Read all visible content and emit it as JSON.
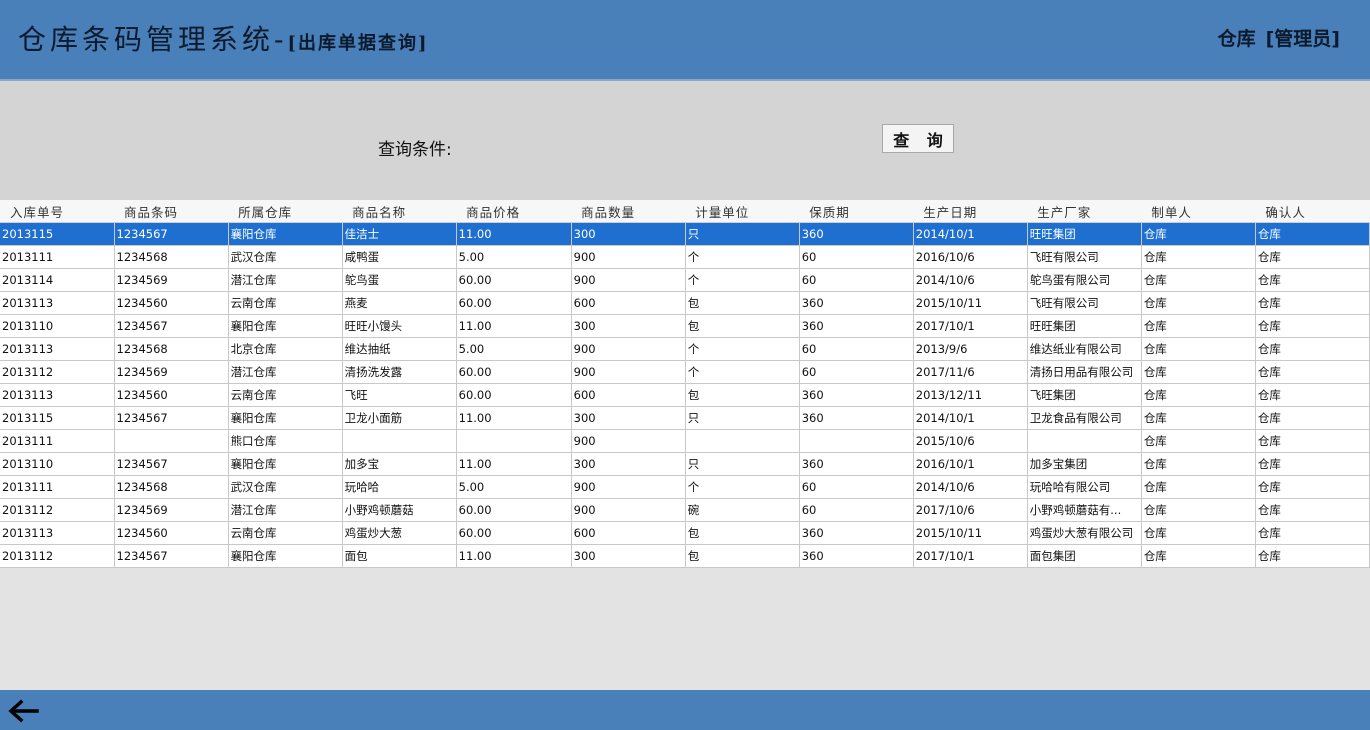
{
  "header": {
    "title": "仓库条码管理系统-",
    "subtitle": "[出库单据查询]",
    "user_name": "仓库",
    "user_role": "[管理员]"
  },
  "query": {
    "label": "查询条件:",
    "button_label": "查 询"
  },
  "table": {
    "columns": [
      "入库单号",
      "商品条码",
      "所属仓库",
      "商品名称",
      "商品价格",
      "商品数量",
      "计量单位",
      "保质期",
      "生产日期",
      "生产厂家",
      "制单人",
      "确认人"
    ],
    "selected_row": 0,
    "rows": [
      [
        "2013115",
        "1234567",
        "襄阳仓库",
        "佳洁士",
        "11.00",
        "300",
        "只",
        "360",
        "2014/10/1",
        "旺旺集团",
        "仓库",
        "仓库"
      ],
      [
        "2013111",
        "1234568",
        "武汉仓库",
        "咸鸭蛋",
        "5.00",
        "900",
        "个",
        "60",
        "2016/10/6",
        "飞旺有限公司",
        "仓库",
        "仓库"
      ],
      [
        "2013114",
        "1234569",
        "潜江仓库",
        "鸵鸟蛋",
        "60.00",
        "900",
        "个",
        "60",
        "2014/10/6",
        "鸵鸟蛋有限公司",
        "仓库",
        "仓库"
      ],
      [
        "2013113",
        "1234560",
        "云南仓库",
        "燕麦",
        "60.00",
        "600",
        "包",
        "360",
        "2015/10/11",
        "飞旺有限公司",
        "仓库",
        "仓库"
      ],
      [
        "2013110",
        "1234567",
        "襄阳仓库",
        "旺旺小馒头",
        "11.00",
        "300",
        "包",
        "360",
        "2017/10/1",
        "旺旺集团",
        "仓库",
        "仓库"
      ],
      [
        "2013113",
        "1234568",
        "北京仓库",
        "维达抽纸",
        "5.00",
        "900",
        "个",
        "60",
        "2013/9/6",
        "维达纸业有限公司",
        "仓库",
        "仓库"
      ],
      [
        "2013112",
        "1234569",
        "潜江仓库",
        "清扬洗发露",
        "60.00",
        "900",
        "个",
        "60",
        "2017/11/6",
        "清扬日用品有限公司",
        "仓库",
        "仓库"
      ],
      [
        "2013113",
        "1234560",
        "云南仓库",
        "飞旺",
        "60.00",
        "600",
        "包",
        "360",
        "2013/12/11",
        "飞旺集团",
        "仓库",
        "仓库"
      ],
      [
        "2013115",
        "1234567",
        "襄阳仓库",
        "卫龙小面筋",
        "11.00",
        "300",
        "只",
        "360",
        "2014/10/1",
        "卫龙食品有限公司",
        "仓库",
        "仓库"
      ],
      [
        "2013111",
        "",
        "熊口仓库",
        "",
        "",
        "900",
        "",
        "",
        "2015/10/6",
        "",
        "仓库",
        "仓库"
      ],
      [
        "2013110",
        "1234567",
        "襄阳仓库",
        "加多宝",
        "11.00",
        "300",
        "只",
        "360",
        "2016/10/1",
        "加多宝集团",
        "仓库",
        "仓库"
      ],
      [
        "2013111",
        "1234568",
        "武汉仓库",
        "玩哈哈",
        "5.00",
        "900",
        "个",
        "60",
        "2014/10/6",
        "玩哈哈有限公司",
        "仓库",
        "仓库"
      ],
      [
        "2013112",
        "1234569",
        "潜江仓库",
        "小野鸡顿蘑菇",
        "60.00",
        "900",
        "碗",
        "60",
        "2017/10/6",
        "小野鸡顿蘑菇有...",
        "仓库",
        "仓库"
      ],
      [
        "2013113",
        "1234560",
        "云南仓库",
        "鸡蛋炒大葱",
        "60.00",
        "600",
        "包",
        "360",
        "2015/10/11",
        "鸡蛋炒大葱有限公司",
        "仓库",
        "仓库"
      ],
      [
        "2013112",
        "1234567",
        "襄阳仓库",
        "面包",
        "11.00",
        "300",
        "包",
        "360",
        "2017/10/1",
        "面包集团",
        "仓库",
        "仓库"
      ]
    ]
  },
  "footer": {
    "back_icon": "arrow-left-icon"
  },
  "colors": {
    "header_bg": "#4a80ba",
    "selected_row": "#1f6fd0",
    "panel_bg": "#d4d4d4"
  }
}
